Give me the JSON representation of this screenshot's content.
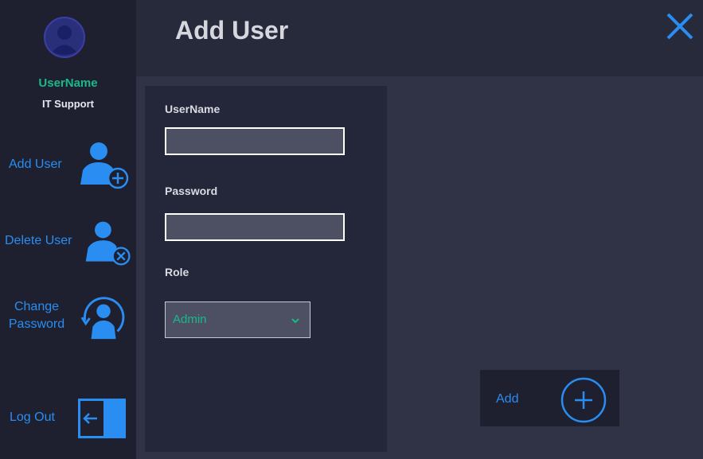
{
  "window": {
    "title": "Add User"
  },
  "user": {
    "name": "UserName",
    "role": "IT Support"
  },
  "sidebar": {
    "items": [
      {
        "label": "Add User",
        "icon": "user-add-icon"
      },
      {
        "label": "Delete User",
        "icon": "user-delete-icon"
      },
      {
        "label_line1": "Change",
        "label_line2": "Password",
        "icon": "user-password-icon"
      },
      {
        "label": "Log Out",
        "icon": "logout-icon"
      }
    ]
  },
  "form": {
    "username_label": "UserName",
    "username_value": "",
    "password_label": "Password",
    "password_value": "",
    "role_label": "Role",
    "role_selected": "Admin"
  },
  "actions": {
    "add_label": "Add"
  },
  "colors": {
    "accent": "#2a8df2",
    "highlight": "#1bb98a",
    "sidebar_bg": "#1e2030",
    "header_bg": "#262a3b",
    "panel_bg": "#242739",
    "content_bg": "#2f3345"
  }
}
